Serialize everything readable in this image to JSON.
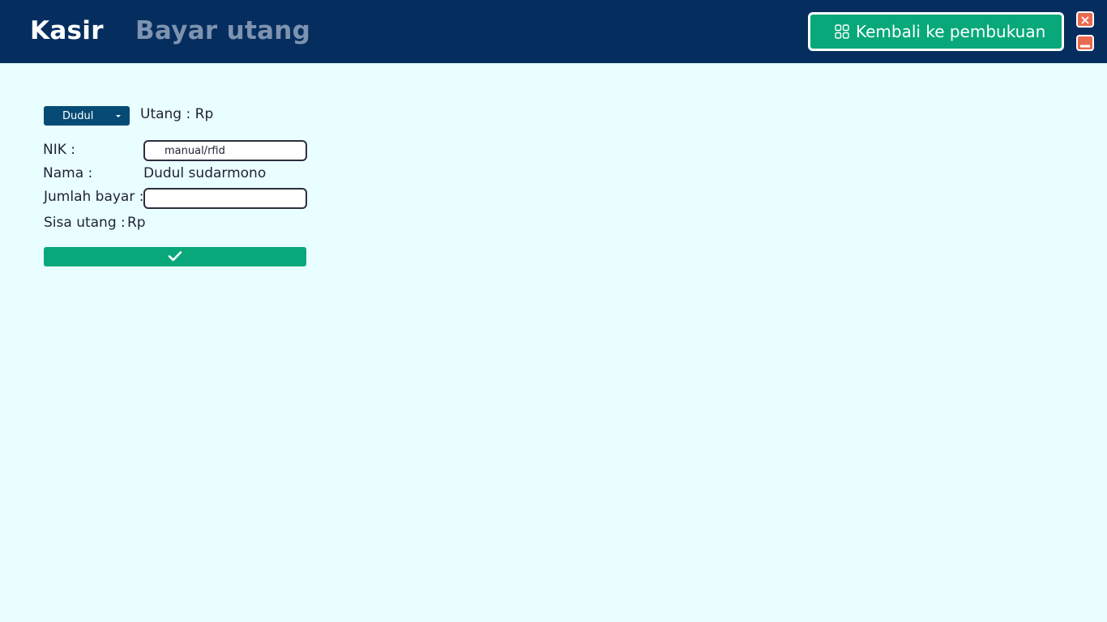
{
  "header": {
    "app_title": "Kasir",
    "page_title": "Bayar utang",
    "back_button_label": "Kembali ke pembukuan",
    "back_button_icon": "grid-icon",
    "close_icon": "close-icon",
    "minimize_icon": "minimize-icon"
  },
  "form": {
    "customer_select_value": "Dudul",
    "debt_label": "Utang : Rp",
    "nik_label": "NIK :",
    "nik_placeholder": "manual/rfid",
    "name_label": "Nama :",
    "name_value": "Dudul sudarmono",
    "amount_label": "Jumlah bayar :",
    "amount_value": "",
    "remaining_label": "Sisa utang :",
    "remaining_value": "Rp",
    "submit_icon": "check-icon"
  },
  "colors": {
    "header_bg": "#052e5e",
    "page_bg": "#e9feff",
    "accent_green": "#08a87a",
    "select_bg": "#054b75",
    "window_button": "#e86a4f",
    "page_title_muted": "#7e93b0"
  }
}
